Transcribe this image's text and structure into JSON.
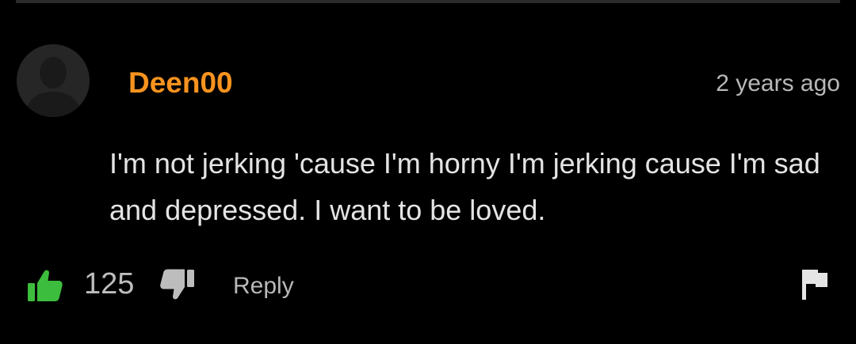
{
  "comment": {
    "username": "Deen00",
    "timestamp": "2 years ago",
    "body": "I'm not jerking 'cause I'm horny I'm jerking cause I'm sad and depressed. I want to be loved.",
    "likes": "125",
    "reply_label": "Reply"
  },
  "icons": {
    "avatar": "default-user-avatar-icon",
    "like": "thumbs-up-icon",
    "dislike": "thumbs-down-icon",
    "report": "flag-icon"
  },
  "colors": {
    "background": "#000000",
    "username": "#f7931e",
    "like_active": "#3dbd3d",
    "text": "#e4e4e4",
    "muted": "#b8b8b8"
  }
}
